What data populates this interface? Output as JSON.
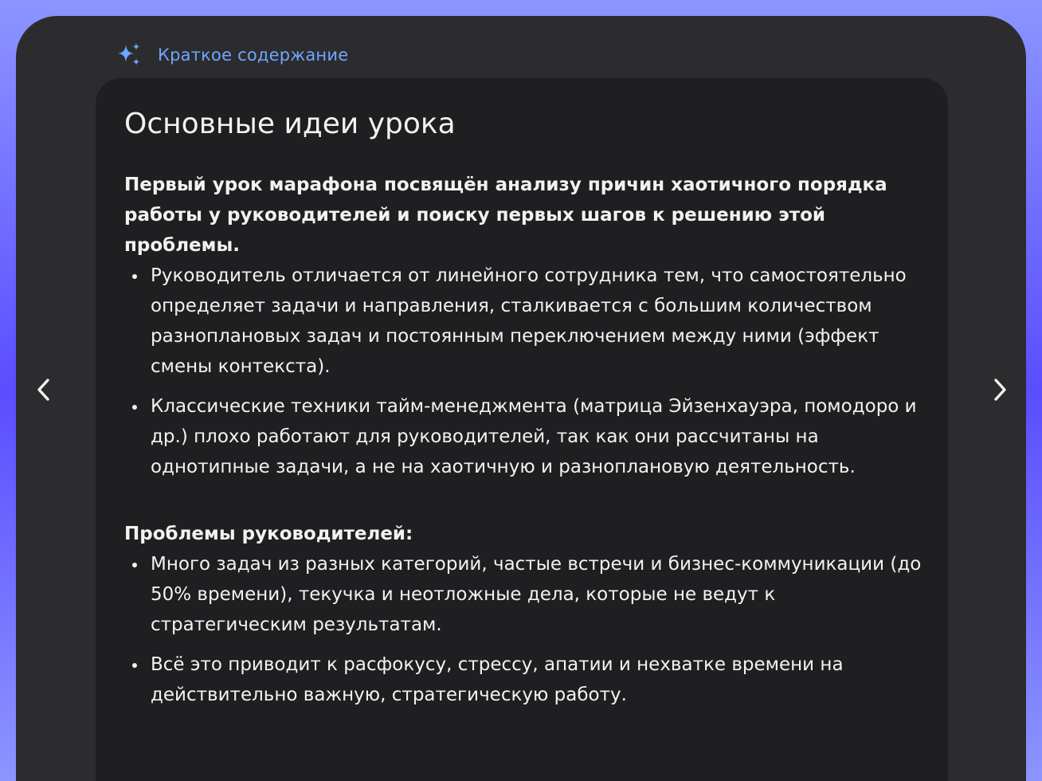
{
  "header": {
    "label": "Краткое содержание",
    "icon": "sparkle-icon",
    "accent": "#6ea6ff"
  },
  "card": {
    "title": "Основные идеи урока",
    "lead": "Первый урок марафона посвящён анализу причин хаотичного порядка работы у руководителей и поиску первых шагов к решению этой проблемы.",
    "points": [
      "Руководитель отличается от линейного сотрудника тем, что самостоятельно определяет задачи и направления, сталкивается с большим количеством разноплановых задач и постоянным переключением между ними (эффект смены контекста).",
      "Классические техники тайм-менеджмента (матрица Эйзенхауэра, помодоро и др.) плохо работают для руководителей, так как они рассчитаны на однотипные задачи, а не на хаотичную и разноплановую деятельность."
    ],
    "section_title": "Проблемы руководителей:",
    "section_points": [
      "Много задач из разных категорий, частые встречи и бизнес-коммуникации (до 50% времени), текучка и неотложные дела, которые не ведут к стратегическим результатам.",
      "Всё это приводит к расфокусу, стрессу, апатии и нехватке времени на действительно важную, стратегическую работу."
    ]
  },
  "nav": {
    "prev_icon": "chevron-left-icon",
    "next_icon": "chevron-right-icon"
  }
}
